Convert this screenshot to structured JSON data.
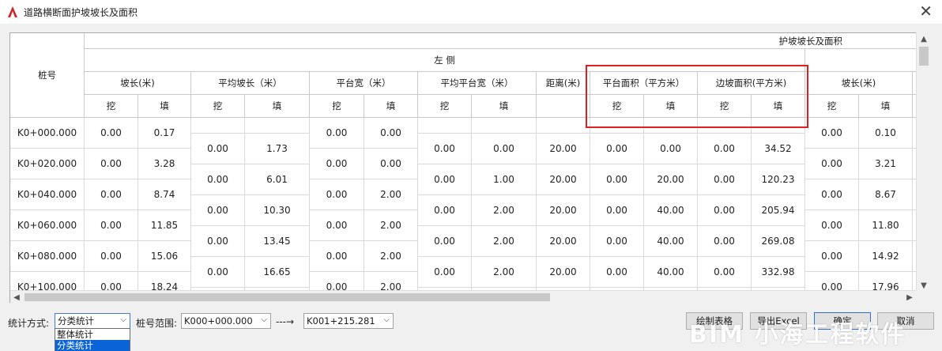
{
  "window": {
    "title": "道路横断面护坡坡长及面积",
    "close_glyph": "✕"
  },
  "table": {
    "header_top": "护坡坡长及面积",
    "header_left_side": "左 侧",
    "col_stake": "桩号",
    "groups": [
      "坡长(米)",
      "平均坡长（米）",
      "平台宽（米）",
      "平均平台宽（米）",
      "距离(米)",
      "平台面积（平方米）",
      "边坡面积(平方米)",
      "坡长(米)"
    ],
    "sub_dig": "挖",
    "sub_fill": "填",
    "stakes": [
      "K0+000.000",
      "K0+020.000",
      "K0+040.000",
      "K0+060.000",
      "K0+080.000",
      "K0+100.000"
    ],
    "slope_dig": [
      "0.00",
      "0.00",
      "0.00",
      "0.00",
      "0.00",
      "0.00"
    ],
    "slope_fill": [
      "0.17",
      "3.28",
      "8.74",
      "11.85",
      "15.06",
      "18.24"
    ],
    "avg_slope_dig": [
      "0.00",
      "0.00",
      "0.00",
      "0.00",
      "0.00"
    ],
    "avg_slope_fill": [
      "1.73",
      "6.01",
      "10.30",
      "13.45",
      "16.65"
    ],
    "plat_dig": [
      "0.00",
      "0.00",
      "0.00",
      "0.00",
      "0.00",
      "0.00"
    ],
    "plat_fill": [
      "0.00",
      "0.00",
      "2.00",
      "2.00",
      "2.00",
      "2.00"
    ],
    "avg_plat_dig": [
      "0.00",
      "0.00",
      "0.00",
      "0.00",
      "0.00"
    ],
    "avg_plat_fill": [
      "0.00",
      "1.00",
      "2.00",
      "2.00",
      "2.00"
    ],
    "distance": [
      "20.00",
      "20.00",
      "20.00",
      "20.00",
      "20.00"
    ],
    "plat_area_dig": [
      "0.00",
      "0.00",
      "0.00",
      "0.00",
      "0.00"
    ],
    "plat_area_fill": [
      "0.00",
      "20.00",
      "40.00",
      "40.00",
      "40.00"
    ],
    "slope_area_dig": [
      "0.00",
      "0.00",
      "0.00",
      "0.00",
      "0.00"
    ],
    "slope_area_fill": [
      "34.52",
      "120.23",
      "205.94",
      "269.08",
      "332.98"
    ],
    "r_slope_dig": [
      "0.00",
      "0.00",
      "0.00",
      "0.00",
      "0.00",
      "0.00"
    ],
    "r_slope_fill": [
      "0.10",
      "3.21",
      "8.67",
      "11.80",
      "14.92",
      "17.96"
    ]
  },
  "scroll": {
    "up": "▲",
    "down": "▼",
    "left": "◀",
    "right": "▶"
  },
  "controls": {
    "stat_label": "统计方式:",
    "stat_value": "分类统计",
    "stat_options": [
      "整体统计",
      "分类统计"
    ],
    "range_label": "桩号范围:",
    "range_from": "K000+000.000",
    "arrow": "---→",
    "range_to": "K001+215.281",
    "btn_draw": "绘制表格",
    "btn_export": "导出Excel",
    "btn_ok": "确定",
    "btn_cancel": "取消",
    "chev": "⌵"
  },
  "watermark": "BIM 小海工程软件",
  "colors": {
    "highlight": "#e02020",
    "accent": "#0a64d8"
  }
}
